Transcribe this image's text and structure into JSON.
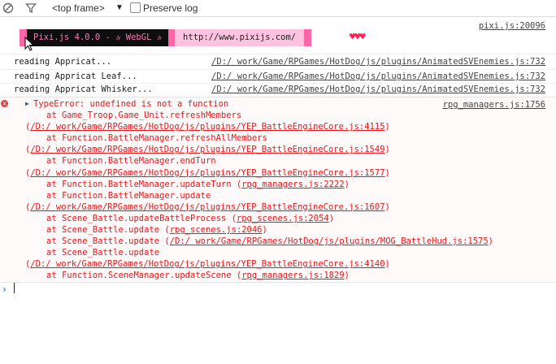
{
  "toolbar": {
    "context": "<top frame>",
    "preserve_log": "Preserve log"
  },
  "pixi_log": {
    "banner_main": "Pixi.js 4.0.0 - ✰ WebGL ✰",
    "banner_url": "http://www.pixijs.com/",
    "hearts": "♥♥♥",
    "source": "pixi.js:20096"
  },
  "logs": [
    {
      "text": "reading Appricat...",
      "source": "/D:/ work/Game/RPGames/HotDog/js/plugins/AnimatedSVEnemies.js:732"
    },
    {
      "text": "reading Appricat Leaf...",
      "source": "/D:/ work/Game/RPGames/HotDog/js/plugins/AnimatedSVEnemies.js:732"
    },
    {
      "text": "reading Appricat Whisker...",
      "source": "/D:/ work/Game/RPGames/HotDog/js/plugins/AnimatedSVEnemies.js:732"
    }
  ],
  "error": {
    "title": "TypeError: undefined is not a function",
    "source": "rpg_managers.js:1756",
    "stack": [
      {
        "pre": "at Game_Troop.Game_Unit.refreshMembers",
        "link": "",
        "post": "",
        "indent": true
      },
      {
        "pre": "(",
        "link": "/D:/ work/Game/RPGames/HotDog/js/plugins/YEP_BattleEngineCore.js:4115",
        "post": ")",
        "indent": false
      },
      {
        "pre": "at Function.BattleManager.refreshAllMembers",
        "link": "",
        "post": "",
        "indent": true
      },
      {
        "pre": "(",
        "link": "/D:/ work/Game/RPGames/HotDog/js/plugins/YEP_BattleEngineCore.js:1549",
        "post": ")",
        "indent": false
      },
      {
        "pre": "at Function.BattleManager.endTurn",
        "link": "",
        "post": "",
        "indent": true
      },
      {
        "pre": "(",
        "link": "/D:/ work/Game/RPGames/HotDog/js/plugins/YEP_BattleEngineCore.js:1577",
        "post": ")",
        "indent": false
      },
      {
        "pre": "at Function.BattleManager.updateTurn (",
        "link": "rpg_managers.js:2222",
        "post": ")",
        "indent": true
      },
      {
        "pre": "at Function.BattleManager.update",
        "link": "",
        "post": "",
        "indent": true
      },
      {
        "pre": "(",
        "link": "/D:/ work/Game/RPGames/HotDog/js/plugins/YEP_BattleEngineCore.js:1607",
        "post": ")",
        "indent": false
      },
      {
        "pre": "at Scene_Battle.updateBattleProcess (",
        "link": "rpg_scenes.js:2054",
        "post": ")",
        "indent": true
      },
      {
        "pre": "at Scene_Battle.update (",
        "link": "rpg_scenes.js:2046",
        "post": ")",
        "indent": true
      },
      {
        "pre": "at Scene_Battle.update (",
        "link": "/D:/ work/Game/RPGames/HotDog/js/plugins/MOG_BattleHud.js:1575",
        "post": ")",
        "indent": true
      },
      {
        "pre": "at Scene_Battle.update",
        "link": "",
        "post": "",
        "indent": true
      },
      {
        "pre": "(",
        "link": "/D:/ work/Game/RPGames/HotDog/js/plugins/YEP_BattleEngineCore.js:4140",
        "post": ")",
        "indent": false
      },
      {
        "pre": "at Function.SceneManager.updateScene (",
        "link": "rpg_managers.js:1829",
        "post": ")",
        "indent": true
      }
    ]
  },
  "prompt_symbol": "›"
}
